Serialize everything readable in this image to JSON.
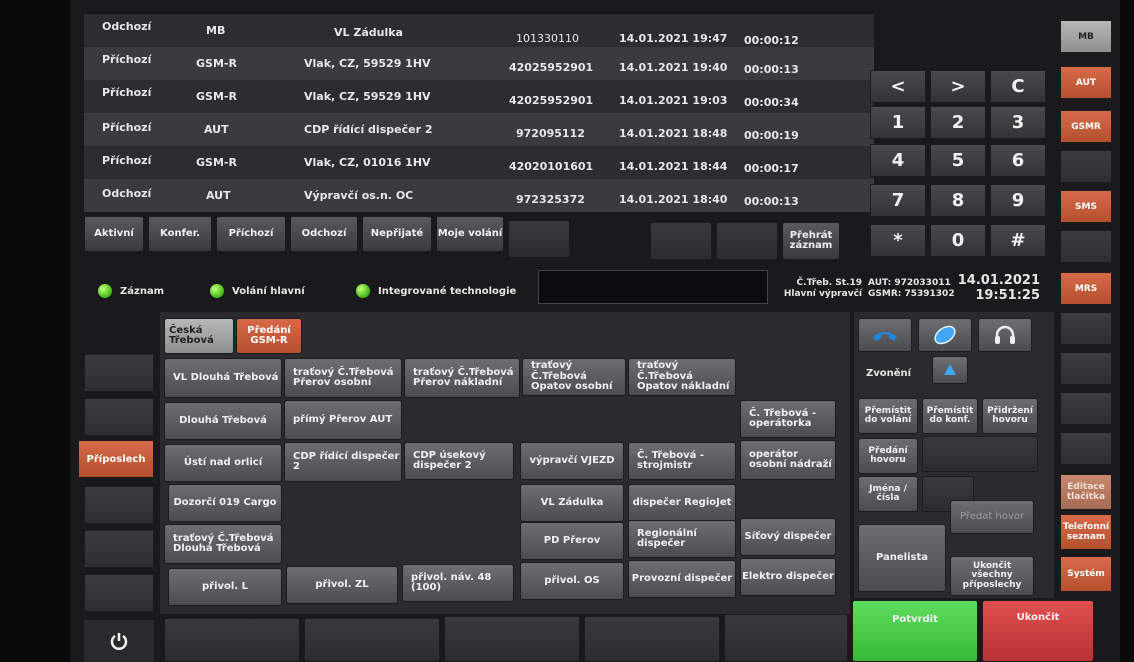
{
  "calls": [
    {
      "dir": "Odchozí",
      "type": "MB",
      "name": "VL Zádulka",
      "number": "101330110",
      "datetime": "14.01.2021 19:47",
      "duration": "00:00:12"
    },
    {
      "dir": "Příchozí",
      "type": "GSM-R",
      "name": "Vlak, CZ, 59529 1HV",
      "number": "42025952901",
      "datetime": "14.01.2021 19:40",
      "duration": "00:00:13"
    },
    {
      "dir": "Příchozí",
      "type": "GSM-R",
      "name": "Vlak, CZ, 59529 1HV",
      "number": "42025952901",
      "datetime": "14.01.2021 19:03",
      "duration": "00:00:34"
    },
    {
      "dir": "Příchozí",
      "type": "AUT",
      "name": "CDP řídící dispečer 2",
      "number": "972095112",
      "datetime": "14.01.2021 18:48",
      "duration": "00:00:19"
    },
    {
      "dir": "Příchozí",
      "type": "GSM-R",
      "name": "Vlak, CZ, 01016 1HV",
      "number": "42020101601",
      "datetime": "14.01.2021 18:44",
      "duration": "00:00:17"
    },
    {
      "dir": "Odchozí",
      "type": "AUT",
      "name": "Výpravčí os.n. OC",
      "number": "972325372",
      "datetime": "14.01.2021 18:40",
      "duration": "00:00:13"
    }
  ],
  "filters": {
    "aktivni": "Aktivní",
    "konfer": "Konfer.",
    "prichozi": "Příchozí",
    "odchozi": "Odchozí",
    "neprijate": "Nepřijaté",
    "moje": "Moje volání",
    "prehrat": "Přehrát záznam"
  },
  "keypad": {
    "lt": "<",
    "gt": ">",
    "clear": "C",
    "k1": "1",
    "k2": "2",
    "k3": "3",
    "k4": "4",
    "k5": "5",
    "k6": "6",
    "k7": "7",
    "k8": "8",
    "k9": "9",
    "star": "*",
    "k0": "0",
    "hash": "#"
  },
  "right_side": {
    "mb": "MB",
    "aut": "AUT",
    "gsmr": "GSMR",
    "sms": "SMS",
    "mrs": "MRS",
    "editace": "Editace tlačítka",
    "telefonni": "Telefonní seznam",
    "system": "Systém"
  },
  "status": {
    "zaznam": "Záznam",
    "volani_hlavni": "Volání hlavní",
    "integrovane": "Integrované technologie",
    "station": "Č.Třeb. St.19",
    "role": "Hlavní výpravčí",
    "aut": "AUT: 972033011",
    "gsmr": "GSMR: 75391302",
    "date": "14.01.2021",
    "time": "19:51:25"
  },
  "tabs": {
    "ceska": "Česká Třebová",
    "predani": "Předání GSM-R"
  },
  "left_side": {
    "priposlech": "Příposlech"
  },
  "grid": {
    "r1": [
      "VL Dlouhá Třebová",
      "traťový Č.Třebová Přerov osobní",
      "traťový Č.Třebová Přerov nákladní",
      "traťový Č.Třebová Opatov osobní",
      "traťový Č.Třebová Opatov nákladní"
    ],
    "r2": [
      "Dlouhá Třebová",
      "přímý Přerov AUT",
      "Č. Třebová - operátorka"
    ],
    "r3": [
      "Ústí nad orlicí",
      "CDP řídící dispečer 2",
      "CDP úsekový dispečer 2",
      "výpravčí VJEZD",
      "Č. Třebová - strojmistr",
      "operátor osobní nádraží"
    ],
    "r4": [
      "Dozorčí 019 Cargo",
      "VL Zádulka",
      "dispečer RegioJet"
    ],
    "r5": [
      "PD Přerov",
      "Regionální dispečer",
      "Síťový dispečer"
    ],
    "r6": [
      "traťový Č.Třebová Dlouhá Třebová"
    ],
    "r7": [
      "přivol. L",
      "přivol. ZL",
      "přivol. náv. 48 (100)",
      "přivol. OS",
      "Provozní dispečer",
      "Elektro dispečer"
    ]
  },
  "call_panel": {
    "zvoneni": "Zvonění",
    "premistit_volani": "Přemístit do volání",
    "premistit_konf": "Přemístit do konf.",
    "pridrzeni": "Přidržení hovoru",
    "predani_hovoru": "Předání hovoru",
    "jmena": "Jména / čísla",
    "panelista": "Panelista",
    "predat_hovor": "Předat hovor",
    "ukoncit_vsechny": "Ukončit všechny příposlechy",
    "potvrdit": "Potvrdit",
    "ukoncit": "Ukončit"
  }
}
